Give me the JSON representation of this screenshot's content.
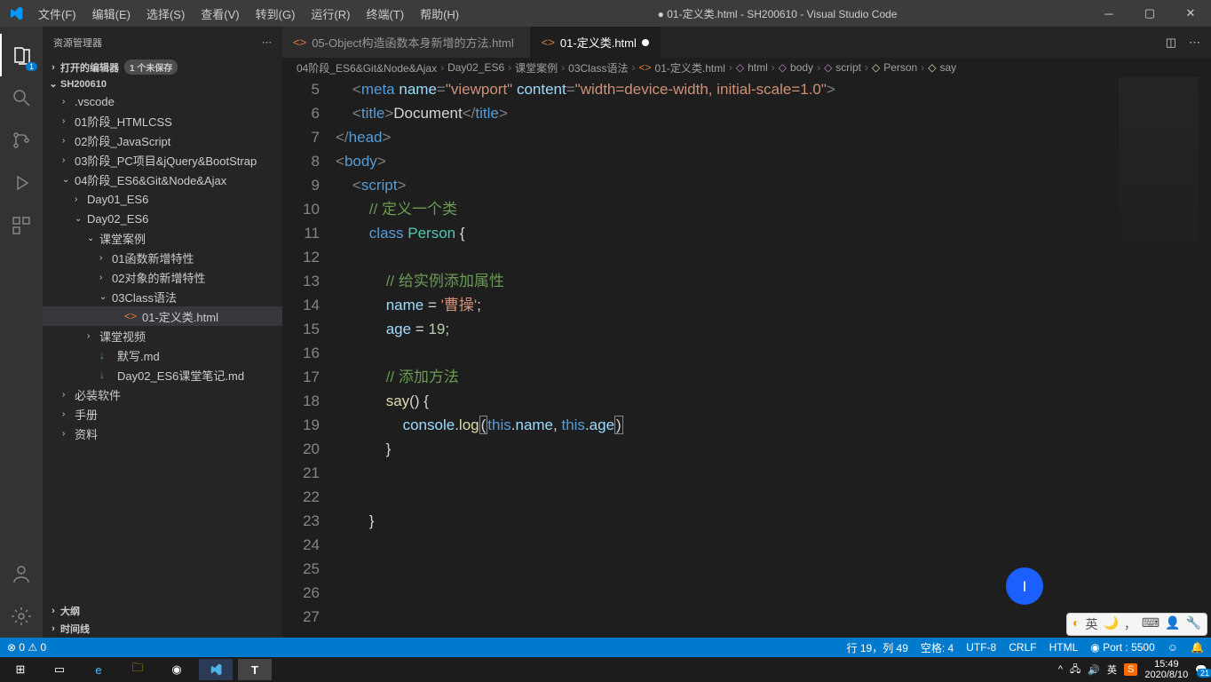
{
  "title": "● 01-定义类.html - SH200610 - Visual Studio Code",
  "menu": [
    "文件(F)",
    "编辑(E)",
    "选择(S)",
    "查看(V)",
    "转到(G)",
    "运行(R)",
    "终端(T)",
    "帮助(H)"
  ],
  "sidebar": {
    "header": "资源管理器",
    "openEditors": "打开的编辑器",
    "unsaved": "1 个未保存",
    "root": "SH200610",
    "items": [
      {
        "label": ".vscode",
        "indent": 1,
        "twisty": "›"
      },
      {
        "label": "01阶段_HTMLCSS",
        "indent": 1,
        "twisty": "›"
      },
      {
        "label": "02阶段_JavaScript",
        "indent": 1,
        "twisty": "›"
      },
      {
        "label": "03阶段_PC项目&jQuery&BootStrap",
        "indent": 1,
        "twisty": "›"
      },
      {
        "label": "04阶段_ES6&Git&Node&Ajax",
        "indent": 1,
        "twisty": "⌄"
      },
      {
        "label": "Day01_ES6",
        "indent": 2,
        "twisty": "›"
      },
      {
        "label": "Day02_ES6",
        "indent": 2,
        "twisty": "⌄"
      },
      {
        "label": "课堂案例",
        "indent": 3,
        "twisty": "⌄"
      },
      {
        "label": "01函数新增特性",
        "indent": 4,
        "twisty": "›"
      },
      {
        "label": "02对象的新增特性",
        "indent": 4,
        "twisty": "›"
      },
      {
        "label": "03Class语法",
        "indent": 4,
        "twisty": "⌄"
      },
      {
        "label": "01-定义类.html",
        "indent": 5,
        "icon": "<>",
        "iconClass": "orange",
        "selected": true
      },
      {
        "label": "课堂视频",
        "indent": 3,
        "twisty": "›"
      },
      {
        "label": "默写.md",
        "indent": 3,
        "icon": "↓",
        "iconClass": "blue"
      },
      {
        "label": "Day02_ES6课堂笔记.md",
        "indent": 3,
        "icon": "↓",
        "iconClass": "blue"
      },
      {
        "label": "必装软件",
        "indent": 1,
        "twisty": "›"
      },
      {
        "label": "手册",
        "indent": 1,
        "twisty": "›"
      },
      {
        "label": "资料",
        "indent": 1,
        "twisty": "›"
      }
    ],
    "outline": "大纲",
    "timeline": "时间线"
  },
  "tabs": [
    {
      "label": "05-Object构造函数本身新增的方法.html",
      "active": false
    },
    {
      "label": "01-定义类.html",
      "active": true,
      "dirty": true
    }
  ],
  "breadcrumb": [
    "04阶段_ES6&Git&Node&Ajax",
    "Day02_ES6",
    "课堂案例",
    "03Class语法",
    "01-定义类.html",
    "html",
    "body",
    "script",
    "Person",
    "say"
  ],
  "lines": {
    "start": 5,
    "end": 27,
    "comment1": "// 定义一个类",
    "comment2": "// 给实例添加属性",
    "comment3": "// 添加方法",
    "nameVal": "'曹操'",
    "ageVal": "19"
  },
  "status": {
    "errors": "⊗ 0 ⚠ 0",
    "pos": "行 19，列 49",
    "spaces": "空格: 4",
    "encoding": "UTF-8",
    "eol": "CRLF",
    "lang": "HTML",
    "port": "Port : 5500"
  },
  "tray": {
    "time": "15:49",
    "date": "2020/8/10",
    "ime": "英"
  }
}
